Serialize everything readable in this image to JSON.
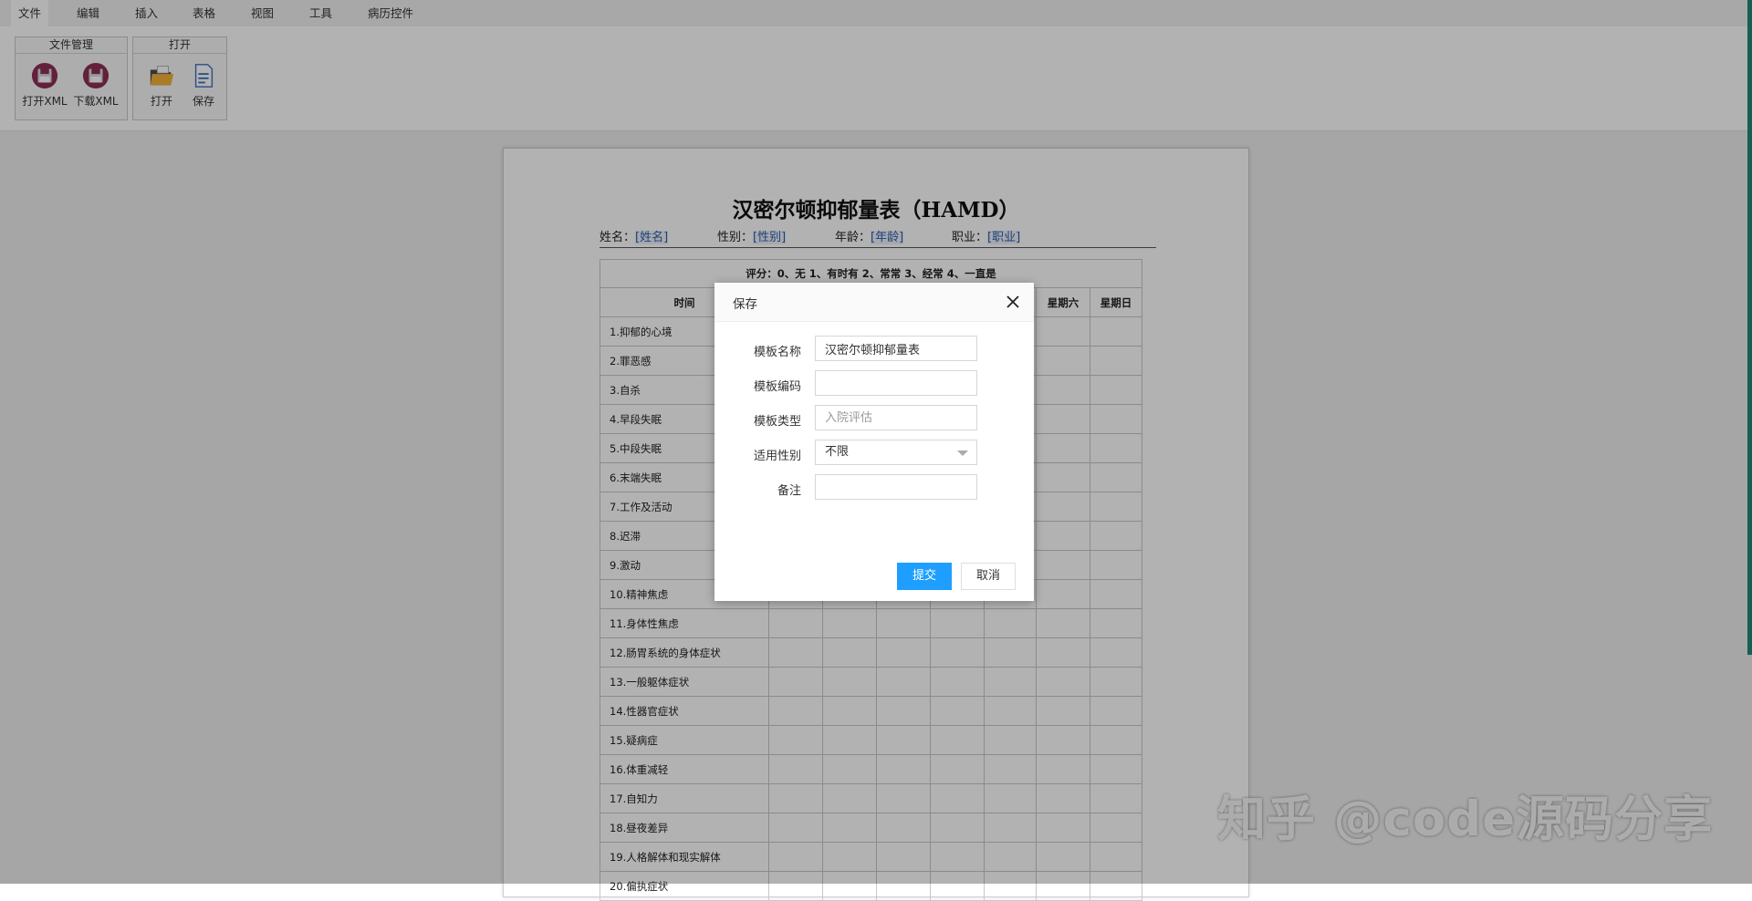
{
  "menu": [
    "文件",
    "编辑",
    "插入",
    "表格",
    "视图",
    "工具",
    "病历控件"
  ],
  "ribbon": {
    "file_group": {
      "title": "文件管理",
      "buttons": [
        {
          "label": "打开XML",
          "icon": "floppy-disk-icon"
        },
        {
          "label": "下载XML",
          "icon": "floppy-disk-icon"
        }
      ]
    },
    "open_group": {
      "title": "打开",
      "buttons": [
        {
          "label": "打开",
          "icon": "folder-icon"
        },
        {
          "label": "保存",
          "icon": "save-document-icon"
        }
      ]
    }
  },
  "document": {
    "title": "汉密尔顿抑郁量表（HAMD）",
    "info": {
      "name_label": "姓名：",
      "name_field": "[姓名]",
      "gender_label": "性别：",
      "gender_field": "[性别]",
      "age_label": "年龄：",
      "age_field": "[年龄]",
      "job_label": "职业：",
      "job_field": "[职业]"
    },
    "table": {
      "score_row": "评分：0、无  1、有时有  2、常常  3、经常  4、一直是",
      "headers": [
        "时间",
        "",
        "",
        "",
        "",
        "",
        "星期六",
        "星期日"
      ],
      "items": [
        "1.抑郁的心境",
        "2.罪恶感",
        "3.自杀",
        "4.早段失眠",
        "5.中段失眠",
        "6.末端失眠",
        "7.工作及活动",
        "8.迟滞",
        "9.激动",
        "10.精神焦虑",
        "11.身体性焦虑",
        "12.肠胃系统的身体症状",
        "13.一般躯体症状",
        "14.性器官症状",
        "15.疑病症",
        "16.体重减轻",
        "17.自知力",
        "18.昼夜差异",
        "19.人格解体和现实解体",
        "20.偏执症状"
      ]
    }
  },
  "dialog": {
    "title": "保存",
    "fields": {
      "name_label": "模板名称",
      "name_value": "汉密尔顿抑郁量表",
      "code_label": "模板编码",
      "code_value": "",
      "type_label": "模板类型",
      "type_placeholder": "入院评估",
      "gender_label": "适用性别",
      "gender_value": "不限",
      "remark_label": "备注",
      "remark_value": ""
    },
    "submit_label": "提交",
    "cancel_label": "取消"
  },
  "watermark": "知乎 @code源码分享"
}
